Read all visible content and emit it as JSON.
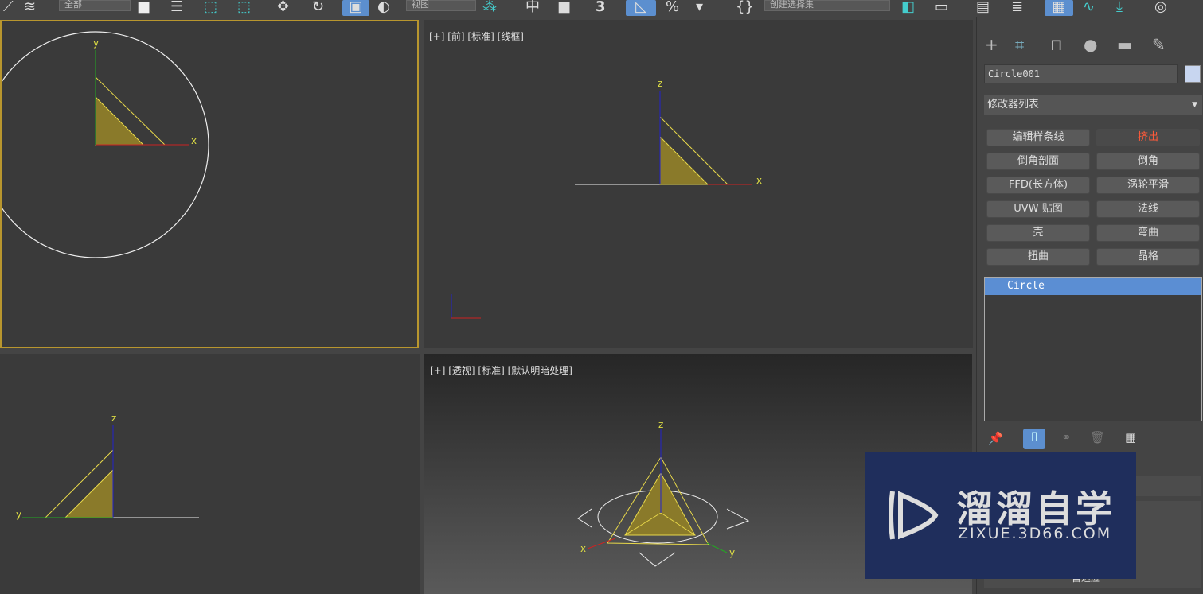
{
  "toolbar": {
    "selection_filter": "全部",
    "reference_coord": "视图",
    "named_selection": "创建选择集",
    "icons": [
      "layers-icon",
      "select-object-icon",
      "select-by-name-icon",
      "rect-selection-icon",
      "window-crossing-icon",
      "move-icon",
      "rotate-icon",
      "scale-icon",
      "torus-icon",
      "pivot-icon",
      "snap-icon",
      "mirror-icon",
      "snap-3-icon",
      "angle-snap-icon",
      "percent-snap-icon",
      "spinner-snap-icon",
      "edit-named-sel-icon",
      "mirror-tool-icon",
      "align-icon",
      "scene-explorer-icon",
      "layer-explorer-icon",
      "ribbon-icon",
      "curve-editor-icon",
      "schematic-icon",
      "material-editor-icon"
    ]
  },
  "viewports": {
    "top_left": {
      "axes": [
        "y",
        "x"
      ]
    },
    "front": {
      "label": "[+] [前] [标准] [线框]",
      "axes": [
        "z",
        "x"
      ]
    },
    "bottom_left": {
      "axes": [
        "z",
        "y"
      ]
    },
    "perspective": {
      "label": "[+] [透视] [标准] [默认明暗处理]",
      "axes": [
        "z",
        "x",
        "y"
      ]
    }
  },
  "command_panel": {
    "tabs": [
      "create-icon",
      "modify-icon",
      "hierarchy-icon",
      "motion-icon",
      "display-icon",
      "utilities-icon"
    ],
    "object_name": "Circle001",
    "object_color": "#c8d6f0",
    "modifier_list": "修改器列表",
    "modifier_buttons": [
      "编辑样条线",
      "挤出",
      "倒角剖面",
      "倒角",
      "FFD(长方体)",
      "涡轮平滑",
      "UVW 贴图",
      "法线",
      "壳",
      "弯曲",
      "扭曲",
      "晶格"
    ],
    "highlighted_button": "挤出",
    "stack": [
      "Circle"
    ],
    "stack_tools": [
      "pin-stack-icon",
      "show-end-result-icon",
      "make-unique-icon",
      "remove-modifier-icon",
      "configure-sets-icon"
    ],
    "partial_text": "自适应"
  },
  "watermark": {
    "title": "溜溜自学",
    "url": "ZIXUE.3D66.COM"
  }
}
